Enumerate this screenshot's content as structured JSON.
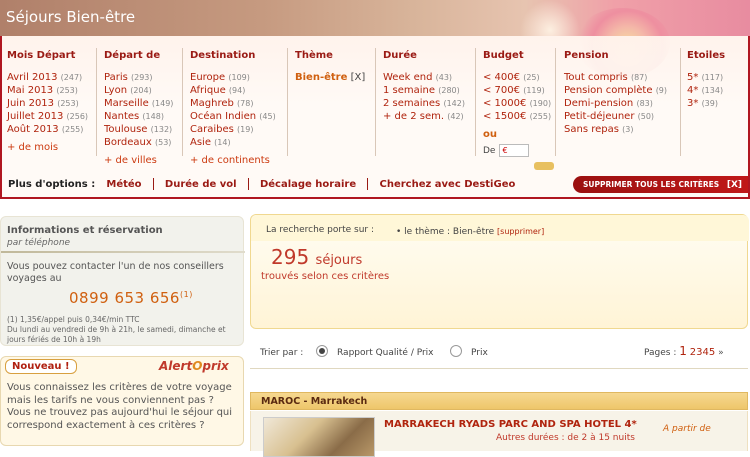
{
  "banner": {
    "title": "Séjours Bien-être"
  },
  "criteria": {
    "mois": {
      "title": "Mois Départ",
      "items": [
        {
          "label": "Avril 2013",
          "count": "(247)"
        },
        {
          "label": "Mai 2013",
          "count": "(253)"
        },
        {
          "label": "Juin 2013",
          "count": "(253)"
        },
        {
          "label": "Juillet 2013",
          "count": "(256)"
        },
        {
          "label": "Août 2013",
          "count": "(255)"
        }
      ],
      "more": "+ de mois"
    },
    "depart": {
      "title": "Départ de",
      "items": [
        {
          "label": "Paris",
          "count": "(293)"
        },
        {
          "label": "Lyon",
          "count": "(204)"
        },
        {
          "label": "Marseille",
          "count": "(149)"
        },
        {
          "label": "Nantes",
          "count": "(148)"
        },
        {
          "label": "Toulouse",
          "count": "(132)"
        },
        {
          "label": "Bordeaux",
          "count": "(53)"
        }
      ],
      "more": "+ de villes"
    },
    "destination": {
      "title": "Destination",
      "items": [
        {
          "label": "Europe",
          "count": "(109)"
        },
        {
          "label": "Afrique",
          "count": "(94)"
        },
        {
          "label": "Maghreb",
          "count": "(78)"
        },
        {
          "label": "Océan Indien",
          "count": "(45)"
        },
        {
          "label": "Caraibes",
          "count": "(19)"
        },
        {
          "label": "Asie",
          "count": "(14)"
        }
      ],
      "more": "+ de continents"
    },
    "theme": {
      "title": "Thème",
      "selected": "Bien-être",
      "remove": "[X]"
    },
    "duree": {
      "title": "Durée",
      "items": [
        {
          "label": "Week end",
          "count": "(43)"
        },
        {
          "label": "1 semaine",
          "count": "(280)"
        },
        {
          "label": "2 semaines",
          "count": "(142)"
        },
        {
          "label": "+ de 2 sem.",
          "count": "(42)"
        }
      ]
    },
    "budget": {
      "title": "Budget",
      "items": [
        {
          "label": "< 400€",
          "count": "(25)"
        },
        {
          "label": "< 700€",
          "count": "(119)"
        },
        {
          "label": "< 1000€",
          "count": "(190)"
        },
        {
          "label": "< 1500€",
          "count": "(255)"
        }
      ],
      "ou": "ou",
      "de_label": "De",
      "de_value": "€"
    },
    "pension": {
      "title": "Pension",
      "items": [
        {
          "label": "Tout compris",
          "count": "(87)"
        },
        {
          "label": "Pension complète",
          "count": "(9)"
        },
        {
          "label": "Demi-pension",
          "count": "(83)"
        },
        {
          "label": "Petit-déjeuner",
          "count": "(50)"
        },
        {
          "label": "Sans repas",
          "count": "(3)"
        }
      ]
    },
    "etoiles": {
      "title": "Etoiles",
      "items": [
        {
          "label": "5*",
          "count": "(117)"
        },
        {
          "label": "4*",
          "count": "(134)"
        },
        {
          "label": "3*",
          "count": "(39)"
        }
      ]
    }
  },
  "options": {
    "label": "Plus d'options :",
    "links": [
      "Météo",
      "Durée de vol",
      "Décalage horaire",
      "Cherchez avec DestiGeo"
    ],
    "clear": "SUPPRIMER TOUS LES CRITÈRES",
    "clear_x": "[X]"
  },
  "info": {
    "title": "Informations et réservation",
    "subtitle": "par téléphone",
    "text": "Vous pouvez contacter l'un de nos conseillers voyages au",
    "phone": "0899 653 656",
    "phone_sup": "(1)",
    "small1": "(1) 1,35€/appel puis 0,34€/min TTC",
    "small2": "Du lundi au vendredi de 9h à 21h, le samedi, dimanche et jours fériés de 10h à 19h"
  },
  "nouveau": {
    "tab": "Nouveau !",
    "brand_a": "Alert",
    "brand_b": "O",
    "brand_c": "prix",
    "text1": "Vous connaissez les critères de votre voyage mais les tarifs ne vous conviennent pas ?",
    "text2": "Vous ne trouvez pas aujourd'hui le séjour qui correspond exactement à ces critères ?"
  },
  "summary": {
    "label": "La recherche porte sur :",
    "criterion": "• le thème : Bien-être",
    "remove": "[supprimer]",
    "count": "295",
    "unit": "séjours",
    "sub": "trouvés selon ces critères"
  },
  "sort": {
    "label": "Trier par :",
    "opt1": "Rapport Qualité / Prix",
    "opt2": "Prix",
    "pages_label": "Pages :",
    "current": "1",
    "pages": [
      "2",
      "3",
      "4",
      "5"
    ],
    "next": "»"
  },
  "result": {
    "region": "MAROC - Marrakech",
    "hotel": "MARRAKECH RYADS PARC AND SPA HOTEL 4*",
    "sub": "Autres durées : de 2 à 15 nuits",
    "price_label": "A partir de"
  }
}
